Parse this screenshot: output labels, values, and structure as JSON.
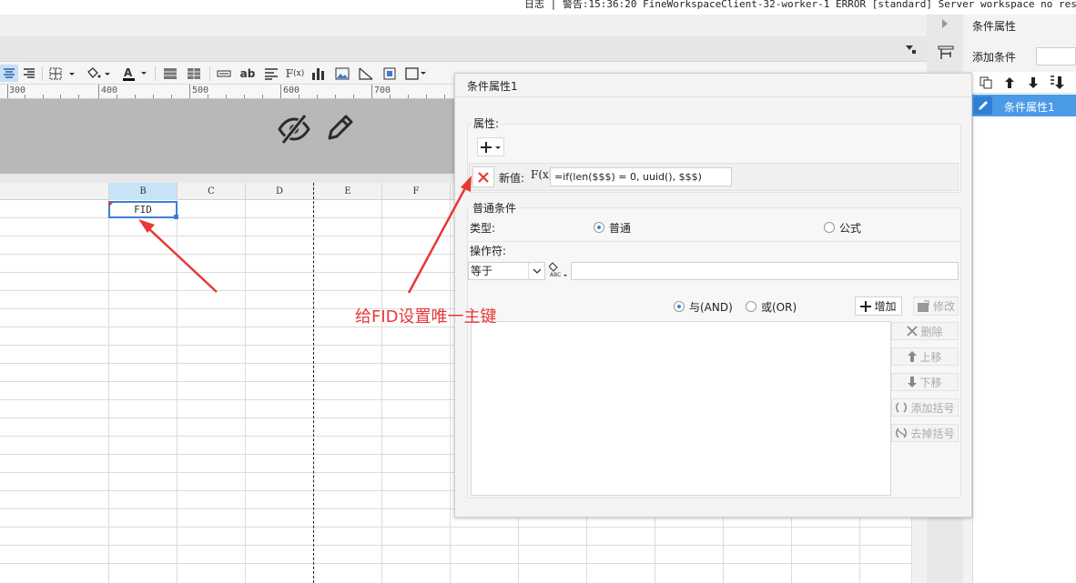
{
  "log": {
    "text": "日志 | 警告:15:36:20 FineWorkspaceClient-32-worker-1 ERROR [standard] Server workspace no response.  C"
  },
  "ruler": {
    "labels": [
      "300",
      "400",
      "500",
      "600",
      "700"
    ]
  },
  "grid": {
    "columns": [
      "B",
      "C",
      "D",
      "E",
      "F"
    ],
    "selected_column": "B",
    "cell_value": "FID"
  },
  "right_panel": {
    "title": "条件属性",
    "add_label": "添加条件",
    "item_label": "条件属性1"
  },
  "dialog": {
    "title": "条件属性1",
    "attributes_label": "属性:",
    "new_value_label": "新值:",
    "fx_label": "F(x)",
    "formula": "=if(len($$$) = 0, uuid(), $$$)",
    "common_label": "普通条件",
    "type_label": "类型:",
    "type_normal": "普通",
    "type_formula": "公式",
    "operator_label": "操作符:",
    "operator_value": "等于",
    "and_label": "与(AND)",
    "or_label": "或(OR)",
    "add_btn": "增加",
    "modify_btn": "修改",
    "delete_btn": "删除",
    "up_btn": "上移",
    "down_btn": "下移",
    "add_paren_btn": "添加括号",
    "remove_paren_btn": "去掉括号"
  },
  "annotation": {
    "text": "给FID设置唯一主键",
    "color": "#e53935"
  },
  "colors": {
    "accent": "#3d7fd6",
    "selection": "#4a9ae8",
    "annotation": "#e53935"
  }
}
